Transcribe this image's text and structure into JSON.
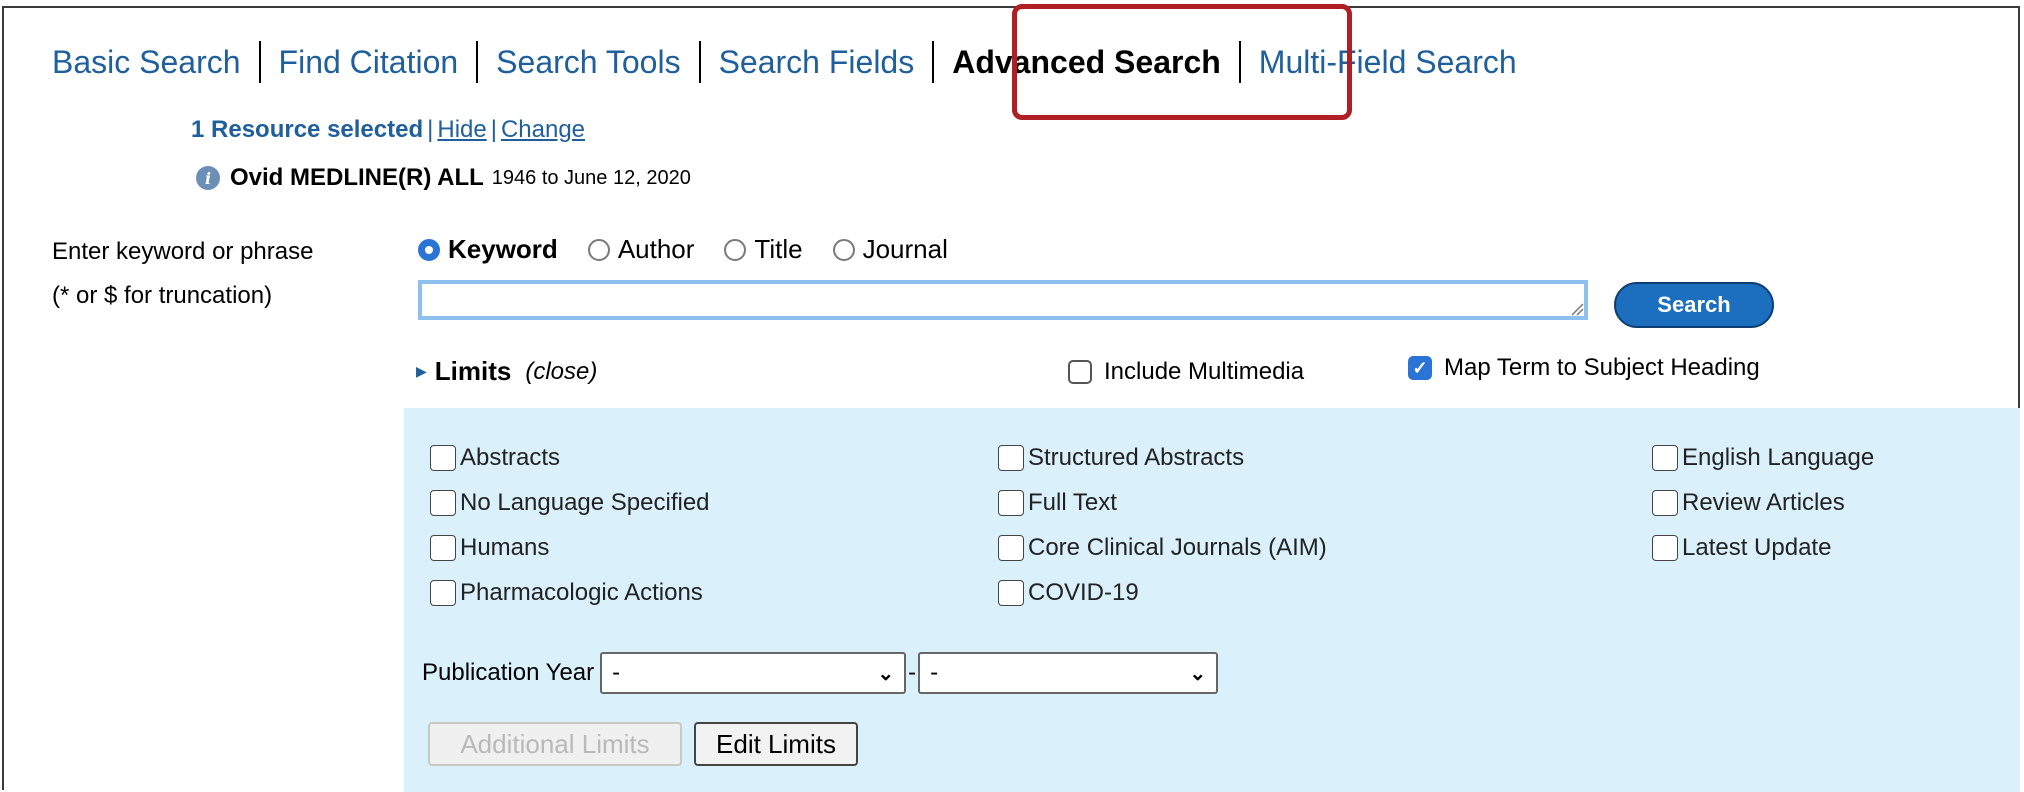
{
  "tabs": [
    {
      "label": "Basic Search",
      "active": false
    },
    {
      "label": "Find Citation",
      "active": false
    },
    {
      "label": "Search Tools",
      "active": false
    },
    {
      "label": "Search Fields",
      "active": false
    },
    {
      "label": "Advanced Search",
      "active": true
    },
    {
      "label": "Multi-Field Search",
      "active": false
    }
  ],
  "resource": {
    "selected_text": "1 Resource selected",
    "hide_link": "Hide",
    "change_link": "Change",
    "separator": "|",
    "db_name": "Ovid MEDLINE(R) ALL",
    "db_range": "1946 to June 12, 2020"
  },
  "search": {
    "label_line1": "Enter keyword or phrase",
    "label_line2": "(* or $ for truncation)",
    "modes": [
      {
        "label": "Keyword",
        "selected": true
      },
      {
        "label": "Author",
        "selected": false
      },
      {
        "label": "Title",
        "selected": false
      },
      {
        "label": "Journal",
        "selected": false
      }
    ],
    "input_value": "",
    "button_label": "Search"
  },
  "limits": {
    "toggle_label": "Limits",
    "close_label": "(close)",
    "include_multimedia": {
      "label": "Include Multimedia",
      "checked": false
    },
    "map_term": {
      "label": "Map Term to Subject Heading",
      "checked": true
    },
    "columns": [
      [
        {
          "label": "Abstracts",
          "checked": false
        },
        {
          "label": "No Language Specified",
          "checked": false
        },
        {
          "label": "Humans",
          "checked": false
        },
        {
          "label": "Pharmacologic Actions",
          "checked": false
        }
      ],
      [
        {
          "label": "Structured Abstracts",
          "checked": false
        },
        {
          "label": "Full Text",
          "checked": false
        },
        {
          "label": "Core Clinical Journals (AIM)",
          "checked": false
        },
        {
          "label": "COVID-19",
          "checked": false
        }
      ],
      [
        {
          "label": "English Language",
          "checked": false
        },
        {
          "label": "Review Articles",
          "checked": false
        },
        {
          "label": "Latest Update",
          "checked": false
        }
      ]
    ],
    "pub_year_label": "Publication Year",
    "pub_year_from": "-",
    "pub_year_dash": "-",
    "pub_year_to": "-",
    "additional_limits_label": "Additional Limits",
    "edit_limits_label": "Edit Limits"
  },
  "colors": {
    "link_blue": "#1f5f9c",
    "highlight_red": "#b01f24",
    "panel_bg": "#daf0fb",
    "search_button": "#1b6fbe"
  }
}
